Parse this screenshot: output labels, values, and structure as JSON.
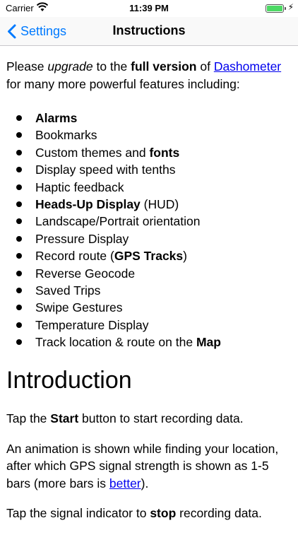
{
  "status_bar": {
    "carrier": "Carrier",
    "time": "11:39 PM"
  },
  "nav": {
    "back_label": "Settings",
    "title": "Instructions"
  },
  "intro_paragraph": {
    "t1": "Please ",
    "upgrade": "upgrade",
    "t2": " to the ",
    "full_version": "full version",
    "t3": " of ",
    "link": "Dashometer",
    "t4": " for many more powerful features including:"
  },
  "features": [
    {
      "bold": "Alarms",
      "rest": ""
    },
    {
      "pre": "Bookmarks"
    },
    {
      "pre": "Custom themes and ",
      "bold": "fonts"
    },
    {
      "pre": "Display speed with tenths"
    },
    {
      "pre": "Haptic feedback"
    },
    {
      "bold": "Heads-Up Display",
      "rest": " (HUD)"
    },
    {
      "pre": "Landscape/Portrait orientation"
    },
    {
      "pre": "Pressure Display"
    },
    {
      "pre": "Record route (",
      "bold": "GPS Tracks",
      "rest": ")"
    },
    {
      "pre": "Reverse Geocode"
    },
    {
      "pre": "Saved Trips"
    },
    {
      "pre": "Swipe Gestures"
    },
    {
      "pre": "Temperature Display"
    },
    {
      "pre": "Track location & route on the ",
      "bold": "Map"
    }
  ],
  "introduction": {
    "heading": "Introduction",
    "p1": {
      "t1": "Tap the ",
      "bold": "Start",
      "t2": " button to start recording data."
    },
    "p2": {
      "t1": "An animation is shown while finding your location, after which GPS signal strength is shown as 1-5 bars (more bars is ",
      "link": "better",
      "t2": ")."
    },
    "p3": {
      "t1": "Tap the signal indicator to ",
      "bold": "stop",
      "t2": " recording data."
    }
  }
}
